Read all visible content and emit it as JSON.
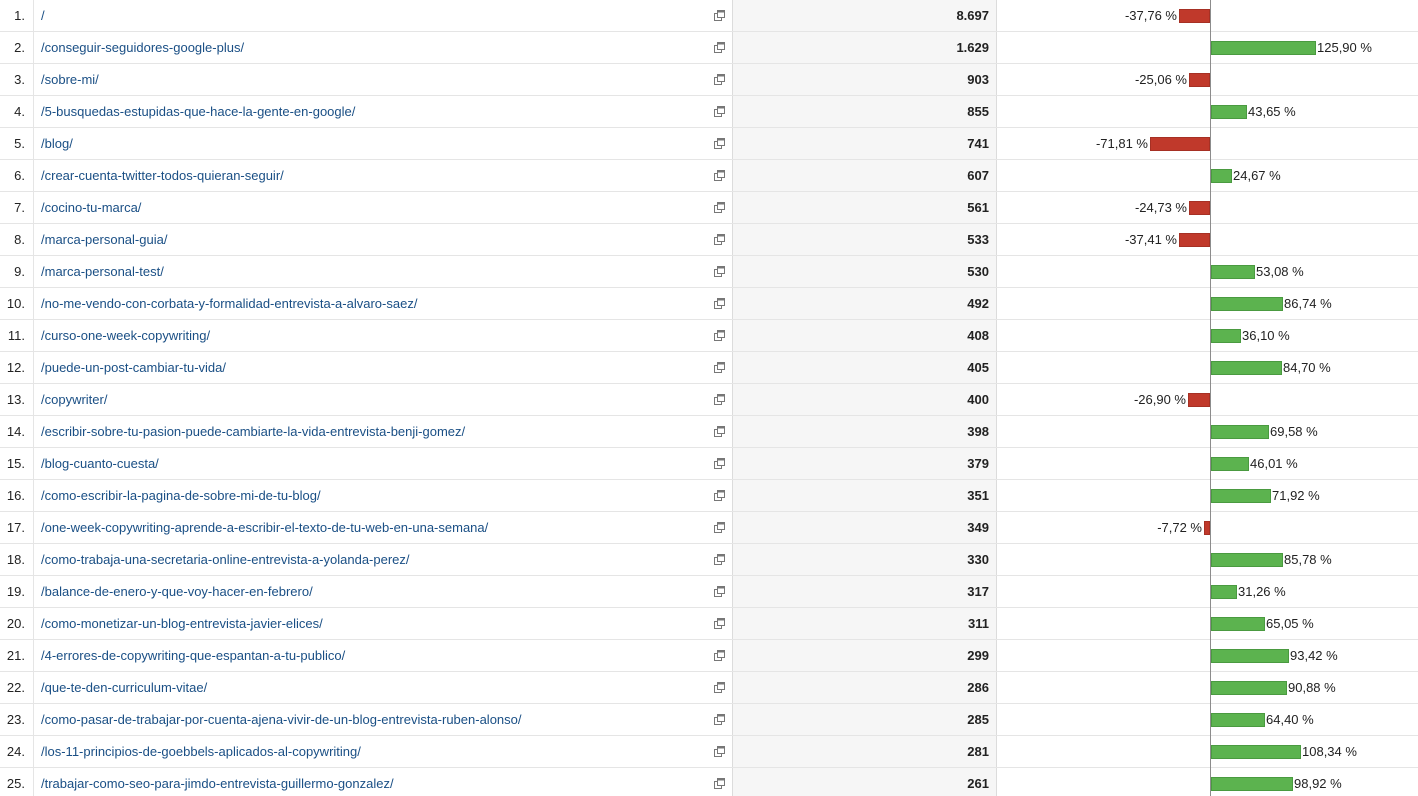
{
  "colors": {
    "positive_bar": "#5cb34f",
    "negative_bar": "#c0392b",
    "link": "#1a4f85"
  },
  "row_icon": "open-in-new-window-icon",
  "rows": [
    {
      "index": "1.",
      "page": "/",
      "value": "8.697",
      "change_label": "-37,76 %",
      "change": -37.76
    },
    {
      "index": "2.",
      "page": "/conseguir-seguidores-google-plus/",
      "value": "1.629",
      "change_label": "125,90 %",
      "change": 125.9
    },
    {
      "index": "3.",
      "page": "/sobre-mi/",
      "value": "903",
      "change_label": "-25,06 %",
      "change": -25.06
    },
    {
      "index": "4.",
      "page": "/5-busquedas-estupidas-que-hace-la-gente-en-google/",
      "value": "855",
      "change_label": "43,65 %",
      "change": 43.65
    },
    {
      "index": "5.",
      "page": "/blog/",
      "value": "741",
      "change_label": "-71,81 %",
      "change": -71.81
    },
    {
      "index": "6.",
      "page": "/crear-cuenta-twitter-todos-quieran-seguir/",
      "value": "607",
      "change_label": "24,67 %",
      "change": 24.67
    },
    {
      "index": "7.",
      "page": "/cocino-tu-marca/",
      "value": "561",
      "change_label": "-24,73 %",
      "change": -24.73
    },
    {
      "index": "8.",
      "page": "/marca-personal-guia/",
      "value": "533",
      "change_label": "-37,41 %",
      "change": -37.41
    },
    {
      "index": "9.",
      "page": "/marca-personal-test/",
      "value": "530",
      "change_label": "53,08 %",
      "change": 53.08
    },
    {
      "index": "10.",
      "page": "/no-me-vendo-con-corbata-y-formalidad-entrevista-a-alvaro-saez/",
      "value": "492",
      "change_label": "86,74 %",
      "change": 86.74
    },
    {
      "index": "11.",
      "page": "/curso-one-week-copywriting/",
      "value": "408",
      "change_label": "36,10 %",
      "change": 36.1
    },
    {
      "index": "12.",
      "page": "/puede-un-post-cambiar-tu-vida/",
      "value": "405",
      "change_label": "84,70 %",
      "change": 84.7
    },
    {
      "index": "13.",
      "page": "/copywriter/",
      "value": "400",
      "change_label": "-26,90 %",
      "change": -26.9
    },
    {
      "index": "14.",
      "page": "/escribir-sobre-tu-pasion-puede-cambiarte-la-vida-entrevista-benji-gomez/",
      "value": "398",
      "change_label": "69,58 %",
      "change": 69.58
    },
    {
      "index": "15.",
      "page": "/blog-cuanto-cuesta/",
      "value": "379",
      "change_label": "46,01 %",
      "change": 46.01
    },
    {
      "index": "16.",
      "page": "/como-escribir-la-pagina-de-sobre-mi-de-tu-blog/",
      "value": "351",
      "change_label": "71,92 %",
      "change": 71.92
    },
    {
      "index": "17.",
      "page": "/one-week-copywriting-aprende-a-escribir-el-texto-de-tu-web-en-una-semana/",
      "value": "349",
      "change_label": "-7,72 %",
      "change": -7.72
    },
    {
      "index": "18.",
      "page": "/como-trabaja-una-secretaria-online-entrevista-a-yolanda-perez/",
      "value": "330",
      "change_label": "85,78 %",
      "change": 85.78
    },
    {
      "index": "19.",
      "page": "/balance-de-enero-y-que-voy-hacer-en-febrero/",
      "value": "317",
      "change_label": "31,26 %",
      "change": 31.26
    },
    {
      "index": "20.",
      "page": "/como-monetizar-un-blog-entrevista-javier-elices/",
      "value": "311",
      "change_label": "65,05 %",
      "change": 65.05
    },
    {
      "index": "21.",
      "page": "/4-errores-de-copywriting-que-espantan-a-tu-publico/",
      "value": "299",
      "change_label": "93,42 %",
      "change": 93.42
    },
    {
      "index": "22.",
      "page": "/que-te-den-curriculum-vitae/",
      "value": "286",
      "change_label": "90,88 %",
      "change": 90.88
    },
    {
      "index": "23.",
      "page": "/como-pasar-de-trabajar-por-cuenta-ajena-vivir-de-un-blog-entrevista-ruben-alonso/",
      "value": "285",
      "change_label": "64,40 %",
      "change": 64.4
    },
    {
      "index": "24.",
      "page": "/los-11-principios-de-goebbels-aplicados-al-copywriting/",
      "value": "281",
      "change_label": "108,34 %",
      "change": 108.34
    },
    {
      "index": "25.",
      "page": "/trabajar-como-seo-para-jimdo-entrevista-guillermo-gonzalez/",
      "value": "261",
      "change_label": "98,92 %",
      "change": 98.92
    }
  ]
}
